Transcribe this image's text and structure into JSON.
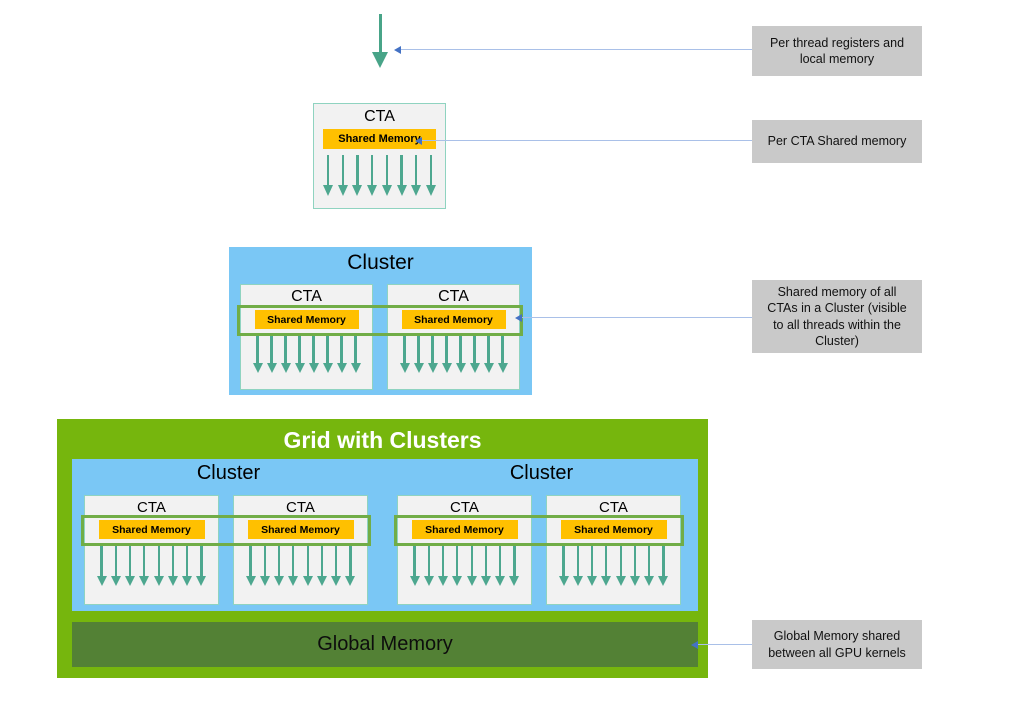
{
  "diagram": {
    "title": "GPU Thread / Memory Hierarchy with Thread Block Clusters",
    "colors": {
      "cluster_blue": "#7ac7f5",
      "grid_green": "#76b60d",
      "global_memory_green": "#538135",
      "shared_memory_amber": "#ffc000",
      "thread_arrow_teal": "#4da78f",
      "cta_fill": "#f2f2f2",
      "cta_border": "#8fd3c0",
      "span_outline_green": "#71ad47",
      "note_gray": "#c9c9c9",
      "connector_blue": "#a9c0e8",
      "connector_head_blue": "#4472c4"
    },
    "labels": {
      "cta": "CTA",
      "shared_memory": "Shared Memory",
      "cluster": "Cluster",
      "grid_with_clusters": "Grid with Clusters",
      "global_memory": "Global Memory"
    },
    "threads_per_cta": 8
  },
  "notes": {
    "thread_registers": "Per thread registers and local memory",
    "cta_shared_memory": "Per CTA Shared memory",
    "cluster_shared_memory": "Shared memory of all CTAs in a Cluster (visible to all threads within the Cluster)",
    "global_memory": "Global Memory shared between all GPU kernels"
  },
  "levels": [
    {
      "id": "thread-level",
      "name": "thread",
      "note_key": "thread_registers"
    },
    {
      "id": "cta-level",
      "name": "cta",
      "cta_label": "CTA",
      "shared_memory_label": "Shared Memory",
      "note_key": "cta_shared_memory"
    },
    {
      "id": "cluster-level",
      "name": "cluster",
      "cluster_label": "Cluster",
      "ctas": [
        {
          "title": "CTA",
          "shared_memory": "Shared Memory"
        },
        {
          "title": "CTA",
          "shared_memory": "Shared Memory"
        }
      ],
      "note_key": "cluster_shared_memory"
    },
    {
      "id": "grid-level",
      "name": "grid",
      "grid_label": "Grid with Clusters",
      "clusters": [
        {
          "label": "Cluster",
          "ctas": [
            {
              "title": "CTA",
              "shared_memory": "Shared Memory"
            },
            {
              "title": "CTA",
              "shared_memory": "Shared Memory"
            }
          ]
        },
        {
          "label": "Cluster",
          "ctas": [
            {
              "title": "CTA",
              "shared_memory": "Shared Memory"
            },
            {
              "title": "CTA",
              "shared_memory": "Shared Memory"
            }
          ]
        }
      ],
      "global_memory_label": "Global Memory",
      "note_key": "global_memory"
    }
  ],
  "texts": {
    "cta_1": "CTA",
    "shmem_1": "Shared Memory",
    "cluster_1_title": "Cluster",
    "cluster_1_cta_a": "CTA",
    "cluster_1_shmem_a": "Shared Memory",
    "cluster_1_cta_b": "CTA",
    "cluster_1_shmem_b": "Shared Memory",
    "grid_title": "Grid with Clusters",
    "grid_cluster_a_title": "Cluster",
    "grid_cluster_a_cta_a": "CTA",
    "grid_cluster_a_shmem_a": "Shared Memory",
    "grid_cluster_a_cta_b": "CTA",
    "grid_cluster_a_shmem_b": "Shared Memory",
    "grid_cluster_b_title": "Cluster",
    "grid_cluster_b_cta_a": "CTA",
    "grid_cluster_b_shmem_a": "Shared Memory",
    "grid_cluster_b_cta_b": "CTA",
    "grid_cluster_b_shmem_b": "Shared Memory",
    "global_memory": "Global Memory",
    "note_thread": "Per thread registers and local memory",
    "note_cta": "Per CTA Shared memory",
    "note_cluster": "Shared memory of all CTAs in a Cluster (visible to all threads within the Cluster)",
    "note_global": "Global Memory shared between all GPU kernels"
  }
}
